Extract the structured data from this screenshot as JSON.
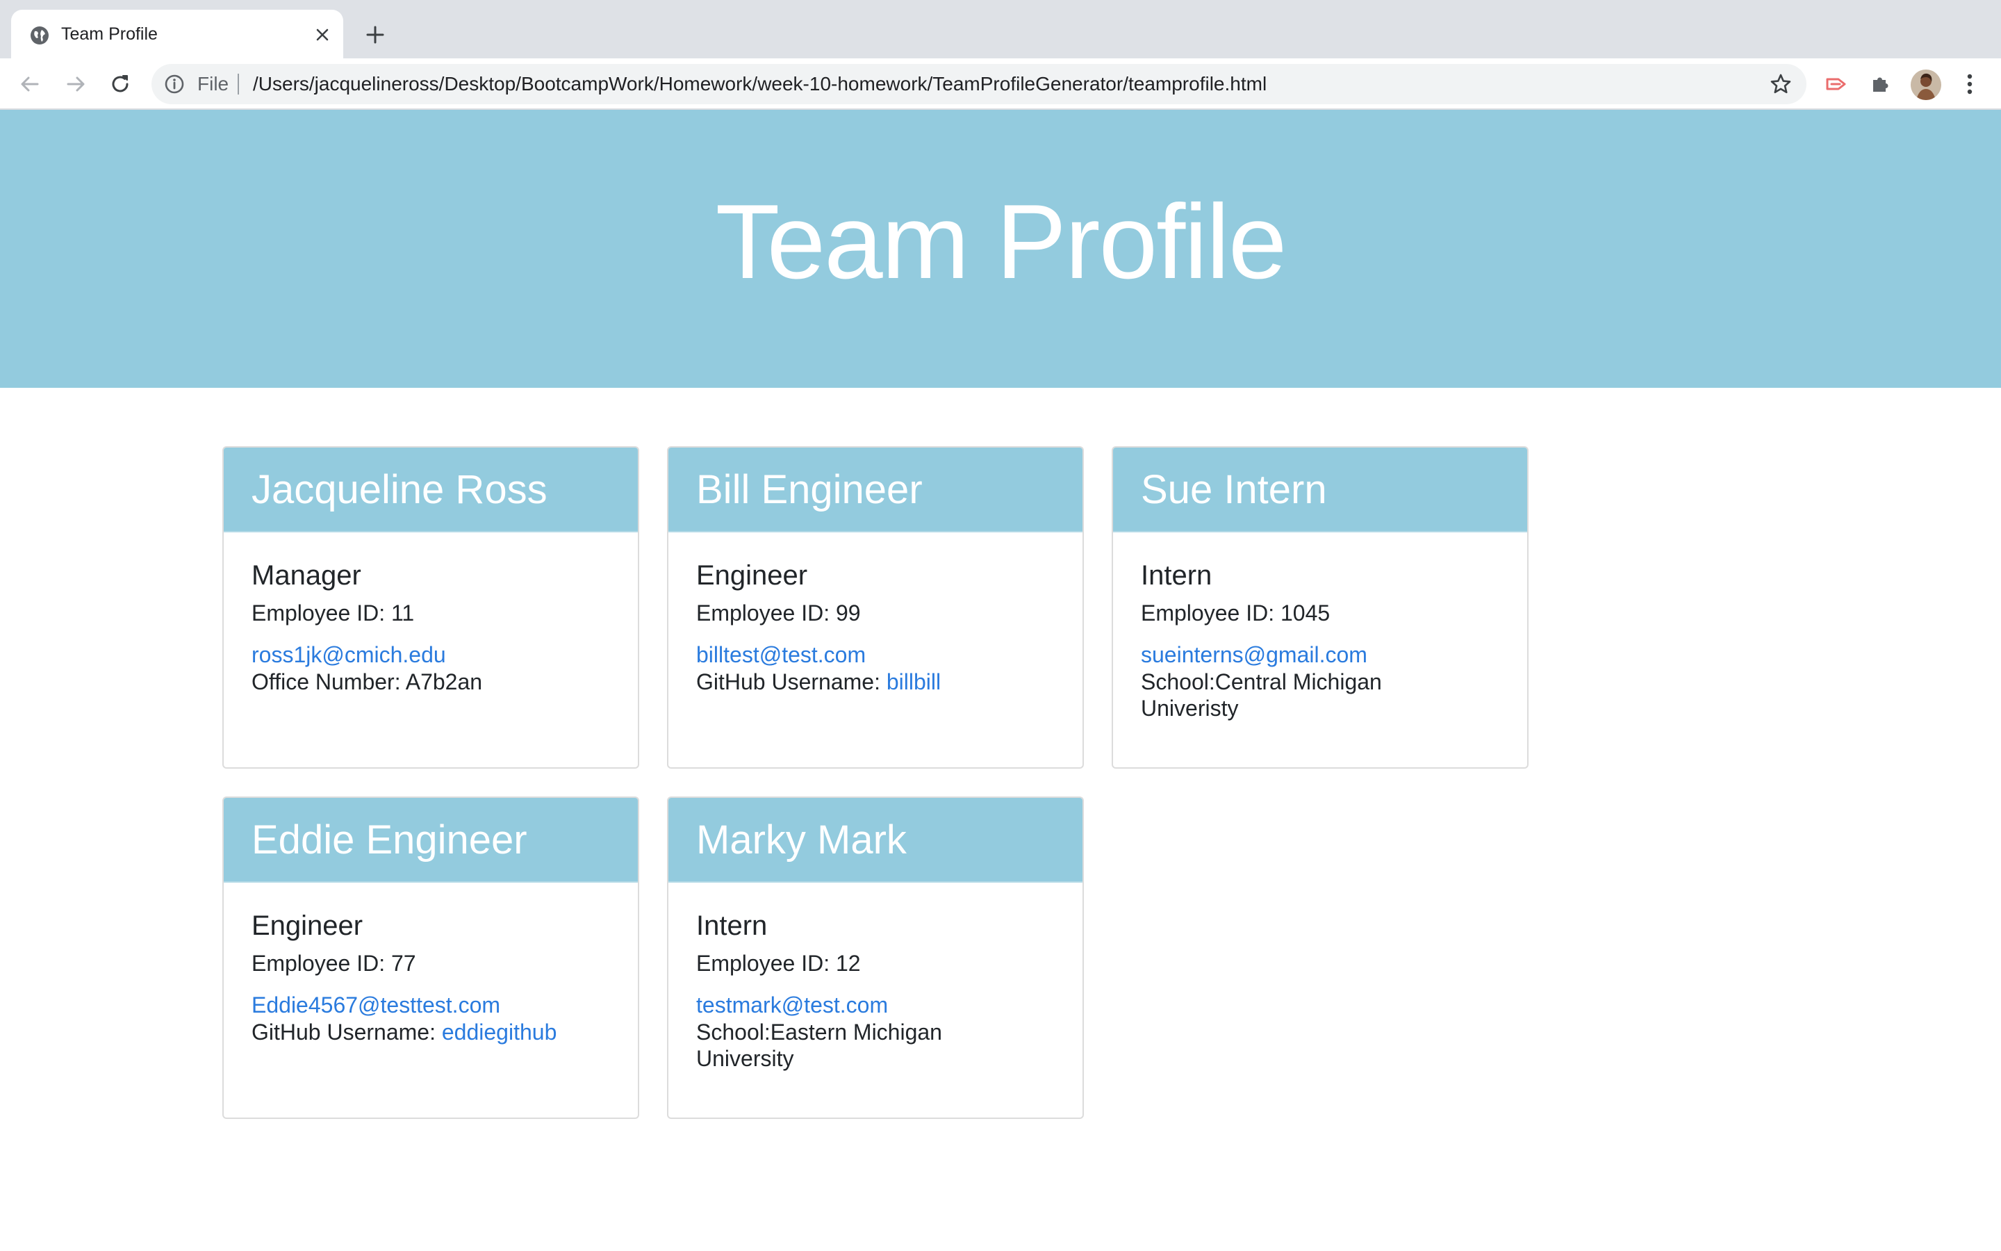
{
  "browser": {
    "tab_title": "Team Profile",
    "address_scheme": "File",
    "url": "/Users/jacquelineross/Desktop/BootcampWork/Homework/week-10-homework/TeamProfileGenerator/teamprofile.html",
    "icons": [
      "globe-icon",
      "close-icon",
      "plus-icon",
      "back-arrow-icon",
      "forward-arrow-icon",
      "reload-icon",
      "info-icon",
      "star-icon",
      "extension-icon",
      "puzzle-icon",
      "avatar",
      "more-vert-icon"
    ]
  },
  "page": {
    "title": "Team Profile",
    "accent_color": "#93cbde",
    "link_color": "#2a7bde"
  },
  "team": [
    {
      "name": "Jacqueline Ross",
      "role": "Manager",
      "id_text": "Employee ID: 11",
      "email": "ross1jk@cmich.edu",
      "extra_label": "Office Number: A7b2an",
      "extra_link": ""
    },
    {
      "name": "Bill Engineer",
      "role": "Engineer",
      "id_text": "Employee ID: 99",
      "email": "billtest@test.com",
      "extra_label": "GitHub Username: ",
      "extra_link": "billbill"
    },
    {
      "name": "Sue Intern",
      "role": "Intern",
      "id_text": "Employee ID: 1045",
      "email": "sueinterns@gmail.com",
      "extra_label": "School:Central Michigan Univeristy",
      "extra_link": ""
    },
    {
      "name": "Eddie Engineer",
      "role": "Engineer",
      "id_text": "Employee ID: 77",
      "email": "Eddie4567@testtest.com",
      "extra_label": "GitHub Username: ",
      "extra_link": "eddiegithub"
    },
    {
      "name": "Marky Mark",
      "role": "Intern",
      "id_text": "Employee ID: 12",
      "email": "testmark@test.com",
      "extra_label": "School:Eastern Michigan University",
      "extra_link": ""
    }
  ]
}
